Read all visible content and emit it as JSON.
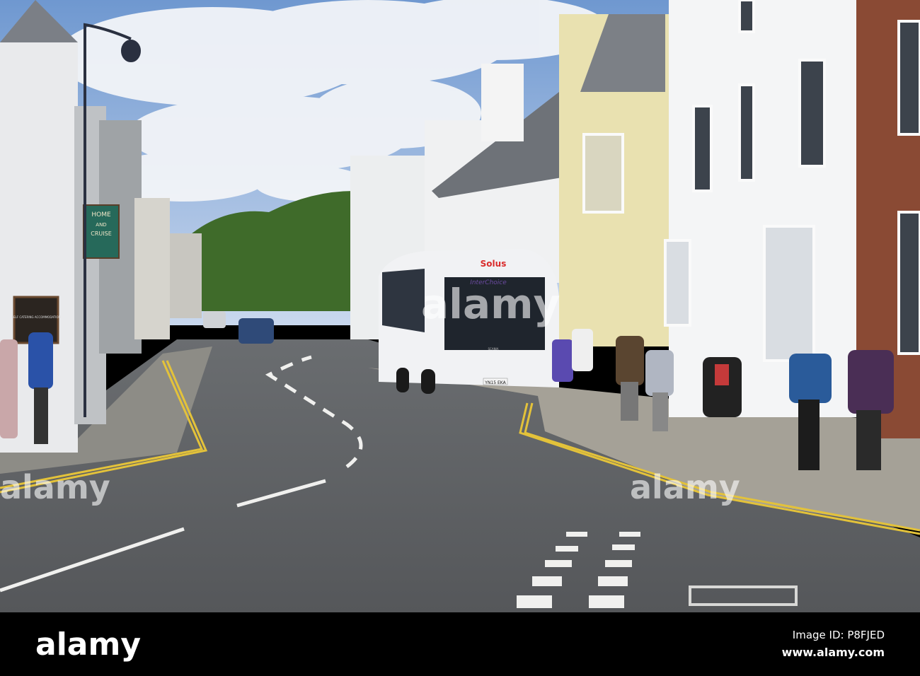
{
  "photo": {
    "bus": {
      "operator": "Solus",
      "brand": "InterChoice",
      "maker": "SCANIA",
      "plate": "YN15 EKA"
    },
    "signs": {
      "shop_sign_line1": "HOME",
      "shop_sign_line2": "AND",
      "shop_sign_line3": "CRUISE",
      "board_text": "SELF CATERING ACCOMMODATION"
    },
    "watermark": "alamy"
  },
  "footer": {
    "logo": "alamy",
    "image_id": "Image ID: P8FJED",
    "url": "www.alamy.com"
  },
  "colors": {
    "sky": "#a9c6ea",
    "road": "#5b5d60",
    "brick": "#8a4a34",
    "yellow_building": "#e9e1b0",
    "footer": "#000000"
  }
}
